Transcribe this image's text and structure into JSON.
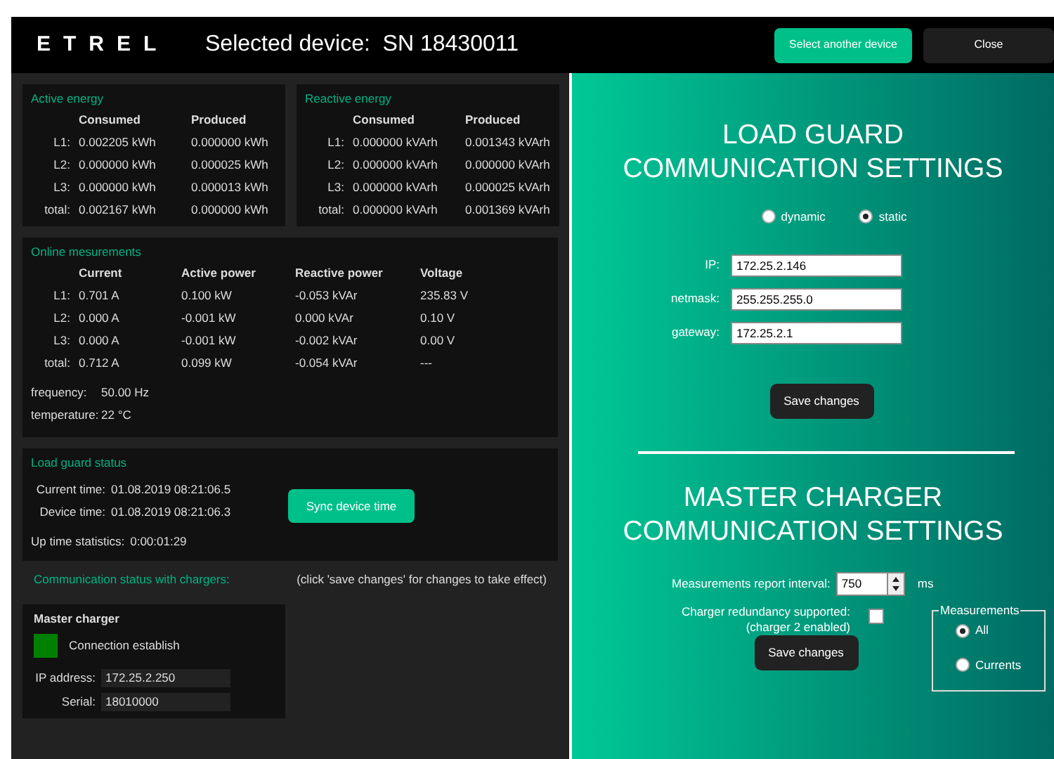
{
  "header": {
    "logo": "ETREL",
    "title": "Selected device:  SN 18430011",
    "buttons": [
      {
        "label": "Select another device",
        "kind": "primary"
      },
      {
        "label": "Close",
        "kind": "secondary"
      }
    ]
  },
  "energy": [
    {
      "title": "Active energy",
      "columns": [
        "Consumed",
        "Produced"
      ],
      "rows": [
        {
          "label": "L1:",
          "values": [
            "0.002205 kWh",
            "0.000000 kWh"
          ]
        },
        {
          "label": "L2:",
          "values": [
            "0.000000 kWh",
            "0.000025 kWh"
          ]
        },
        {
          "label": "L3:",
          "values": [
            "0.000000 kWh",
            "0.000013 kWh"
          ]
        },
        {
          "label": "total:",
          "values": [
            "0.002167 kWh",
            "0.000000 kWh"
          ]
        }
      ]
    },
    {
      "title": "Reactive energy",
      "columns": [
        "Consumed",
        "Produced"
      ],
      "rows": [
        {
          "label": "L1:",
          "values": [
            "0.000000 kVArh",
            "0.001343 kVArh"
          ]
        },
        {
          "label": "L2:",
          "values": [
            "0.000000 kVArh",
            "0.000000 kVArh"
          ]
        },
        {
          "label": "L3:",
          "values": [
            "0.000000 kVArh",
            "0.000025 kVArh"
          ]
        },
        {
          "label": "total:",
          "values": [
            "0.000000 kVArh",
            "0.001369 kVArh"
          ]
        }
      ]
    }
  ],
  "online": {
    "title": "Online mesurements",
    "columns": [
      "Current",
      "Active power",
      "Reactive power",
      "Voltage"
    ],
    "rows": [
      {
        "label": "L1:",
        "values": [
          "0.701 A",
          "0.100 kW",
          "-0.053 kVAr",
          "235.83 V"
        ]
      },
      {
        "label": "L2:",
        "values": [
          "0.000 A",
          "-0.001 kW",
          "0.000 kVAr",
          "0.10 V"
        ]
      },
      {
        "label": "L3:",
        "values": [
          "0.000 A",
          "-0.001 kW",
          "-0.002 kVAr",
          "0.00 V"
        ]
      },
      {
        "label": "total:",
        "values": [
          "0.712 A",
          "0.099 kW",
          "-0.054 kVAr",
          "---"
        ]
      }
    ],
    "extras": [
      {
        "label": "frequency:",
        "value": "50.00 Hz"
      },
      {
        "label": "temperature:",
        "value": "22 °C"
      }
    ]
  },
  "load_guard_status": {
    "title": "Load guard status",
    "times": [
      {
        "label": "Current time:",
        "value": "01.08.2019 08:21:06.5"
      },
      {
        "label": "Device time:",
        "value": "01.08.2019 08:21:06.3"
      }
    ],
    "sync_button": "Sync device time",
    "uptime": {
      "label": "Up time statistics:",
      "value": "0:00:01:29"
    }
  },
  "communication": {
    "title": "Communication status with chargers:",
    "note": "(click 'save changes' for changes to take effect)",
    "master": {
      "title": "Master charger",
      "status": "Connection establish",
      "color": "#008000",
      "fields": [
        {
          "label": "IP address:",
          "value": "172.25.2.250"
        },
        {
          "label": "Serial:",
          "value": "18010000"
        }
      ]
    }
  },
  "load_guard_settings": {
    "title": "LOAD GUARD\nCOMMUNICATION SETTINGS",
    "modes": [
      {
        "label": "dynamic",
        "selected": false
      },
      {
        "label": "static",
        "selected": true
      }
    ],
    "fields": [
      {
        "label": "IP:",
        "value": "172.25.2.146"
      },
      {
        "label": "netmask:",
        "value": "255.255.255.0"
      },
      {
        "label": "gateway:",
        "value": "172.25.2.1"
      }
    ],
    "save_button": "Save changes"
  },
  "master_settings": {
    "title": "MASTER CHARGER\nCOMMUNICATION SETTINGS",
    "interval": {
      "label": "Measurements report interval:",
      "value": "750",
      "unit": "ms"
    },
    "redundancy": {
      "label": "Charger redundancy supported:\n(charger 2 enabled)",
      "checked": false
    },
    "measurements": {
      "legend": "Measurements",
      "options": [
        {
          "label": "All",
          "selected": true
        },
        {
          "label": "Currents",
          "selected": false
        }
      ]
    },
    "save_button": "Save changes"
  }
}
